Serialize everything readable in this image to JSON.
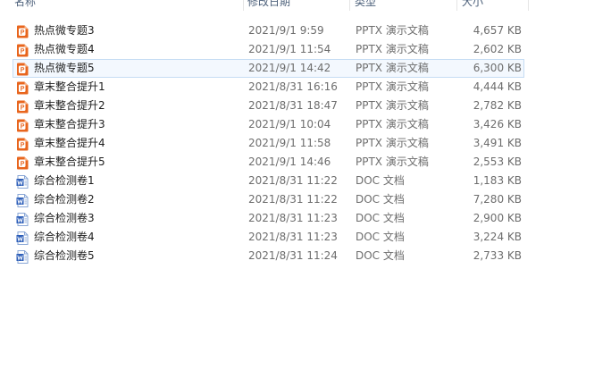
{
  "columns": {
    "name": "名称",
    "date": "修改日期",
    "type": "类型",
    "size": "大小"
  },
  "colors": {
    "ppt_icon": "#e8651d",
    "doc_icon": "#2b5db8",
    "selection_bg": "#f3f8fe",
    "selection_border": "#c5dcf3"
  },
  "files": [
    {
      "name": "热点微专题3",
      "date": "2021/9/1 9:59",
      "type": "PPTX 演示文稿",
      "size": "4,657 KB",
      "icon": "powerpoint-icon"
    },
    {
      "name": "热点微专题4",
      "date": "2021/9/1 11:54",
      "type": "PPTX 演示文稿",
      "size": "2,602 KB",
      "icon": "powerpoint-icon"
    },
    {
      "name": "热点微专题5",
      "date": "2021/9/1 14:42",
      "type": "PPTX 演示文稿",
      "size": "6,300 KB",
      "icon": "powerpoint-icon"
    },
    {
      "name": "章末整合提升1",
      "date": "2021/8/31 16:16",
      "type": "PPTX 演示文稿",
      "size": "4,444 KB",
      "icon": "powerpoint-icon"
    },
    {
      "name": "章末整合提升2",
      "date": "2021/8/31 18:47",
      "type": "PPTX 演示文稿",
      "size": "2,782 KB",
      "icon": "powerpoint-icon"
    },
    {
      "name": "章末整合提升3",
      "date": "2021/9/1 10:04",
      "type": "PPTX 演示文稿",
      "size": "3,426 KB",
      "icon": "powerpoint-icon"
    },
    {
      "name": "章末整合提升4",
      "date": "2021/9/1 11:58",
      "type": "PPTX 演示文稿",
      "size": "3,491 KB",
      "icon": "powerpoint-icon"
    },
    {
      "name": "章末整合提升5",
      "date": "2021/9/1 14:46",
      "type": "PPTX 演示文稿",
      "size": "2,553 KB",
      "icon": "powerpoint-icon"
    },
    {
      "name": "综合检测卷1",
      "date": "2021/8/31 11:22",
      "type": "DOC 文档",
      "size": "1,183 KB",
      "icon": "word-icon"
    },
    {
      "name": "综合检测卷2",
      "date": "2021/8/31 11:22",
      "type": "DOC 文档",
      "size": "7,280 KB",
      "icon": "word-icon"
    },
    {
      "name": "综合检测卷3",
      "date": "2021/8/31 11:23",
      "type": "DOC 文档",
      "size": "2,900 KB",
      "icon": "word-icon"
    },
    {
      "name": "综合检测卷4",
      "date": "2021/8/31 11:23",
      "type": "DOC 文档",
      "size": "3,224 KB",
      "icon": "word-icon"
    },
    {
      "name": "综合检测卷5",
      "date": "2021/8/31 11:24",
      "type": "DOC 文档",
      "size": "2,733 KB",
      "icon": "word-icon"
    }
  ],
  "selected_file": "热点微专题5"
}
